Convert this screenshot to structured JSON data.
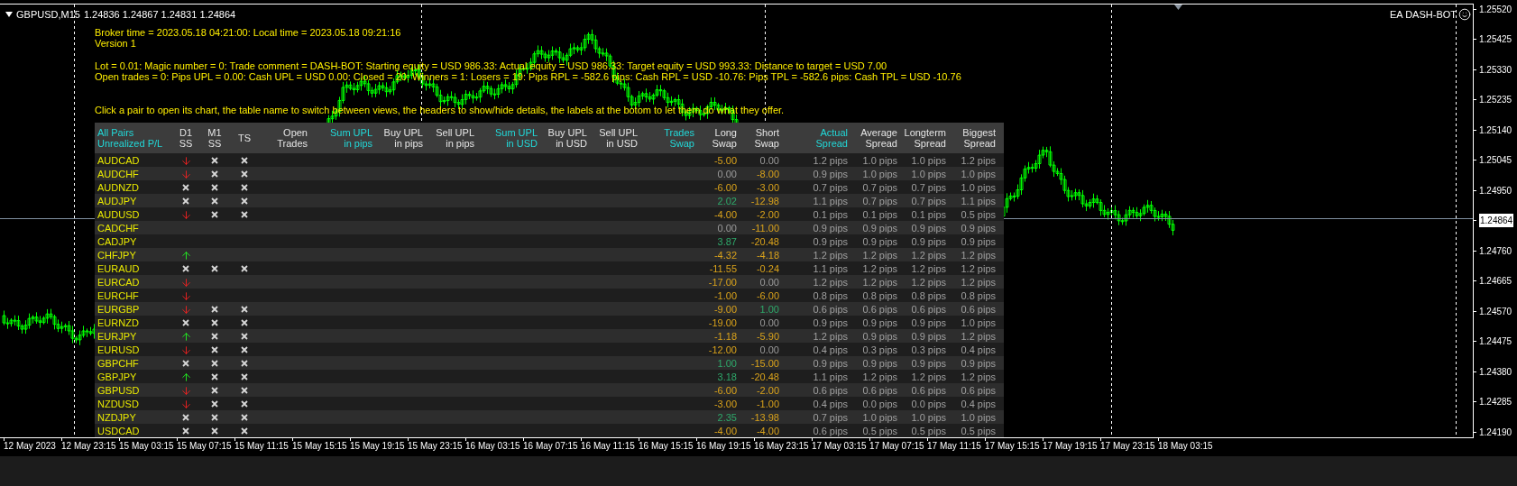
{
  "chart_header": {
    "symbol": "GBPUSD,M15",
    "prices": "1.24836 1.24867 1.24831 1.24864"
  },
  "expert": {
    "name": "EA DASH-BOT"
  },
  "info_blocks": [
    [
      "Broker time = 2023.05.18 04:21:00: Local time = 2023.05.18 09:21:16",
      "Version 1"
    ],
    [
      "Lot = 0.01: Magic number = 0: Trade comment = DASH-BOT: Starting equity = USD 986.33: Actual equity = USD 986.33: Target equity = USD 993.33: Distance to target = USD 7.00",
      "Open trades = 0: Pips UPL = 0.00: Cash UPL = USD 0.00: Closed = 20: Winners = 1: Losers = 19: Pips RPL = -582.6 pips: Cash RPL = USD -10.76: Pips TPL = -582.6 pips: Cash TPL = USD -10.76"
    ],
    [
      "Click a pair to open its chart, the table name to switch between views, the headers to show/hide details, the labels at the botom to let them do what they offer."
    ]
  ],
  "table": {
    "columns": [
      {
        "lines": [
          "All Pairs",
          "Unrealized P/L"
        ],
        "highlighted": true
      },
      {
        "lines": [
          "D1",
          "SS"
        ],
        "highlighted": false
      },
      {
        "lines": [
          "M1",
          "SS"
        ],
        "highlighted": false
      },
      {
        "lines": [
          "TS"
        ],
        "highlighted": false
      },
      {
        "lines": [
          "Open",
          "Trades"
        ],
        "highlighted": false
      },
      {
        "lines": [
          "Sum UPL",
          "in pips"
        ],
        "highlighted": true
      },
      {
        "lines": [
          "Buy UPL",
          "in pips"
        ],
        "highlighted": false
      },
      {
        "lines": [
          "Sell UPL",
          "in pips"
        ],
        "highlighted": false
      },
      {
        "lines": [
          "Sum UPL",
          "in USD"
        ],
        "highlighted": true
      },
      {
        "lines": [
          "Buy UPL",
          "in USD"
        ],
        "highlighted": false
      },
      {
        "lines": [
          "Sell UPL",
          "in USD"
        ],
        "highlighted": false
      },
      {
        "lines": [
          "Trades",
          "Swap"
        ],
        "highlighted": true
      },
      {
        "lines": [
          "Long",
          "Swap"
        ],
        "highlighted": false
      },
      {
        "lines": [
          "Short",
          "Swap"
        ],
        "highlighted": false
      },
      {
        "lines": [
          "Actual",
          "Spread"
        ],
        "highlighted": true
      },
      {
        "lines": [
          "Average",
          "Spread"
        ],
        "highlighted": false
      },
      {
        "lines": [
          "Longterm",
          "Spread"
        ],
        "highlighted": false
      },
      {
        "lines": [
          "Biggest",
          "Spread"
        ],
        "highlighted": false
      }
    ],
    "rows": [
      {
        "pair": "AUDCAD",
        "signals": [
          {
            "kind": "down"
          },
          {
            "kind": "x"
          },
          {
            "kind": "x"
          }
        ],
        "swaps": [
          {
            "text": "-5.00",
            "kind": "negative"
          },
          {
            "text": "0.00",
            "kind": "zero"
          }
        ],
        "spreads": [
          "1.2 pips",
          "1.0 pips",
          "1.0 pips",
          "1.2 pips"
        ]
      },
      {
        "pair": "AUDCHF",
        "signals": [
          {
            "kind": "down"
          },
          {
            "kind": "x"
          },
          {
            "kind": "x"
          }
        ],
        "swaps": [
          {
            "text": "0.00",
            "kind": "zero"
          },
          {
            "text": "-8.00",
            "kind": "negative"
          }
        ],
        "spreads": [
          "0.9 pips",
          "1.0 pips",
          "1.0 pips",
          "1.0 pips"
        ]
      },
      {
        "pair": "AUDNZD",
        "signals": [
          {
            "kind": "x"
          },
          {
            "kind": "x"
          },
          {
            "kind": "x"
          }
        ],
        "swaps": [
          {
            "text": "-6.00",
            "kind": "negative"
          },
          {
            "text": "-3.00",
            "kind": "negative"
          }
        ],
        "spreads": [
          "0.7 pips",
          "0.7 pips",
          "0.7 pips",
          "1.0 pips"
        ]
      },
      {
        "pair": "AUDJPY",
        "signals": [
          {
            "kind": "x"
          },
          {
            "kind": "x"
          },
          {
            "kind": "x"
          }
        ],
        "swaps": [
          {
            "text": "2.02",
            "kind": "positive"
          },
          {
            "text": "-12.98",
            "kind": "negative"
          }
        ],
        "spreads": [
          "1.1 pips",
          "0.7 pips",
          "0.7 pips",
          "1.1 pips"
        ]
      },
      {
        "pair": "AUDUSD",
        "signals": [
          {
            "kind": "down"
          },
          {
            "kind": "x"
          },
          {
            "kind": "x"
          }
        ],
        "swaps": [
          {
            "text": "-4.00",
            "kind": "negative"
          },
          {
            "text": "-2.00",
            "kind": "negative"
          }
        ],
        "spreads": [
          "0.1 pips",
          "0.1 pips",
          "0.1 pips",
          "0.5 pips"
        ]
      },
      {
        "pair": "CADCHF",
        "signals": [
          {
            "kind": "none"
          },
          {
            "kind": "none"
          },
          {
            "kind": "none"
          }
        ],
        "swaps": [
          {
            "text": "0.00",
            "kind": "zero"
          },
          {
            "text": "-11.00",
            "kind": "negative"
          }
        ],
        "spreads": [
          "0.9 pips",
          "0.9 pips",
          "0.9 pips",
          "0.9 pips"
        ]
      },
      {
        "pair": "CADJPY",
        "signals": [
          {
            "kind": "none"
          },
          {
            "kind": "none"
          },
          {
            "kind": "none"
          }
        ],
        "swaps": [
          {
            "text": "3.87",
            "kind": "positive"
          },
          {
            "text": "-20.48",
            "kind": "negative"
          }
        ],
        "spreads": [
          "0.9 pips",
          "0.9 pips",
          "0.9 pips",
          "0.9 pips"
        ]
      },
      {
        "pair": "CHFJPY",
        "signals": [
          {
            "kind": "up"
          },
          {
            "kind": "none"
          },
          {
            "kind": "none"
          }
        ],
        "swaps": [
          {
            "text": "-4.32",
            "kind": "negative"
          },
          {
            "text": "-4.18",
            "kind": "negative"
          }
        ],
        "spreads": [
          "1.2 pips",
          "1.2 pips",
          "1.2 pips",
          "1.2 pips"
        ]
      },
      {
        "pair": "EURAUD",
        "signals": [
          {
            "kind": "x"
          },
          {
            "kind": "x"
          },
          {
            "kind": "x"
          }
        ],
        "swaps": [
          {
            "text": "-11.55",
            "kind": "negative"
          },
          {
            "text": "-0.24",
            "kind": "negative"
          }
        ],
        "spreads": [
          "1.1 pips",
          "1.2 pips",
          "1.2 pips",
          "1.2 pips"
        ]
      },
      {
        "pair": "EURCAD",
        "signals": [
          {
            "kind": "down"
          },
          {
            "kind": "none"
          },
          {
            "kind": "none"
          }
        ],
        "swaps": [
          {
            "text": "-17.00",
            "kind": "negative"
          },
          {
            "text": "0.00",
            "kind": "zero"
          }
        ],
        "spreads": [
          "1.2 pips",
          "1.2 pips",
          "1.2 pips",
          "1.2 pips"
        ]
      },
      {
        "pair": "EURCHF",
        "signals": [
          {
            "kind": "down"
          },
          {
            "kind": "none"
          },
          {
            "kind": "none"
          }
        ],
        "swaps": [
          {
            "text": "-1.00",
            "kind": "negative"
          },
          {
            "text": "-6.00",
            "kind": "negative"
          }
        ],
        "spreads": [
          "0.8 pips",
          "0.8 pips",
          "0.8 pips",
          "0.8 pips"
        ]
      },
      {
        "pair": "EURGBP",
        "signals": [
          {
            "kind": "down"
          },
          {
            "kind": "x"
          },
          {
            "kind": "x"
          }
        ],
        "swaps": [
          {
            "text": "-9.00",
            "kind": "negative"
          },
          {
            "text": "1.00",
            "kind": "positive"
          }
        ],
        "spreads": [
          "0.6 pips",
          "0.6 pips",
          "0.6 pips",
          "0.6 pips"
        ]
      },
      {
        "pair": "EURNZD",
        "signals": [
          {
            "kind": "x"
          },
          {
            "kind": "x"
          },
          {
            "kind": "x"
          }
        ],
        "swaps": [
          {
            "text": "-19.00",
            "kind": "negative"
          },
          {
            "text": "0.00",
            "kind": "zero"
          }
        ],
        "spreads": [
          "0.9 pips",
          "0.9 pips",
          "0.9 pips",
          "1.0 pips"
        ]
      },
      {
        "pair": "EURJPY",
        "signals": [
          {
            "kind": "up"
          },
          {
            "kind": "x"
          },
          {
            "kind": "x"
          }
        ],
        "swaps": [
          {
            "text": "-1.18",
            "kind": "negative"
          },
          {
            "text": "-5.90",
            "kind": "negative"
          }
        ],
        "spreads": [
          "1.2 pips",
          "0.9 pips",
          "0.9 pips",
          "1.2 pips"
        ]
      },
      {
        "pair": "EURUSD",
        "signals": [
          {
            "kind": "down"
          },
          {
            "kind": "x"
          },
          {
            "kind": "x"
          }
        ],
        "swaps": [
          {
            "text": "-12.00",
            "kind": "negative"
          },
          {
            "text": "0.00",
            "kind": "zero"
          }
        ],
        "spreads": [
          "0.4 pips",
          "0.3 pips",
          "0.3 pips",
          "0.4 pips"
        ]
      },
      {
        "pair": "GBPCHF",
        "signals": [
          {
            "kind": "x"
          },
          {
            "kind": "x"
          },
          {
            "kind": "x"
          }
        ],
        "swaps": [
          {
            "text": "1.00",
            "kind": "positive"
          },
          {
            "text": "-15.00",
            "kind": "negative"
          }
        ],
        "spreads": [
          "0.9 pips",
          "0.9 pips",
          "0.9 pips",
          "0.9 pips"
        ]
      },
      {
        "pair": "GBPJPY",
        "signals": [
          {
            "kind": "up"
          },
          {
            "kind": "x"
          },
          {
            "kind": "x"
          }
        ],
        "swaps": [
          {
            "text": "3.18",
            "kind": "positive"
          },
          {
            "text": "-20.48",
            "kind": "negative"
          }
        ],
        "spreads": [
          "1.1 pips",
          "1.2 pips",
          "1.2 pips",
          "1.2 pips"
        ]
      },
      {
        "pair": "GBPUSD",
        "signals": [
          {
            "kind": "down"
          },
          {
            "kind": "x"
          },
          {
            "kind": "x"
          }
        ],
        "swaps": [
          {
            "text": "-6.00",
            "kind": "negative"
          },
          {
            "text": "-2.00",
            "kind": "negative"
          }
        ],
        "spreads": [
          "0.6 pips",
          "0.6 pips",
          "0.6 pips",
          "0.6 pips"
        ]
      },
      {
        "pair": "NZDUSD",
        "signals": [
          {
            "kind": "down"
          },
          {
            "kind": "x"
          },
          {
            "kind": "x"
          }
        ],
        "swaps": [
          {
            "text": "-3.00",
            "kind": "negative"
          },
          {
            "text": "-1.00",
            "kind": "negative"
          }
        ],
        "spreads": [
          "0.4 pips",
          "0.0 pips",
          "0.0 pips",
          "0.4 pips"
        ]
      },
      {
        "pair": "NZDJPY",
        "signals": [
          {
            "kind": "x"
          },
          {
            "kind": "x"
          },
          {
            "kind": "x"
          }
        ],
        "swaps": [
          {
            "text": "2.35",
            "kind": "positive"
          },
          {
            "text": "-13.98",
            "kind": "negative"
          }
        ],
        "spreads": [
          "0.7 pips",
          "1.0 pips",
          "1.0 pips",
          "1.0 pips"
        ]
      },
      {
        "pair": "USDCAD",
        "signals": [
          {
            "kind": "x"
          },
          {
            "kind": "x"
          },
          {
            "kind": "x"
          }
        ],
        "swaps": [
          {
            "text": "-4.00",
            "kind": "negative"
          },
          {
            "text": "-4.00",
            "kind": "negative"
          }
        ],
        "spreads": [
          "0.6 pips",
          "0.5 pips",
          "0.5 pips",
          "0.5 pips"
        ]
      }
    ]
  },
  "price_axis": [
    "1.25520",
    "1.25425",
    "1.25330",
    "1.25235",
    "1.25140",
    "1.25045",
    "1.24950",
    "1.24864",
    "1.24760",
    "1.24665",
    "1.24570",
    "1.24475",
    "1.24380",
    "1.24285",
    "1.24190"
  ],
  "time_axis": [
    "12 May 2023",
    "12 May 23:15",
    "15 May 03:15",
    "15 May 07:15",
    "15 May 11:15",
    "15 May 15:15",
    "15 May 19:15",
    "15 May 23:15",
    "16 May 03:15",
    "16 May 07:15",
    "16 May 11:15",
    "16 May 15:15",
    "16 May 19:15",
    "16 May 23:15",
    "17 May 03:15",
    "17 May 07:15",
    "17 May 11:15",
    "17 May 15:15",
    "17 May 19:15",
    "17 May 23:15",
    "18 May 03:15"
  ]
}
